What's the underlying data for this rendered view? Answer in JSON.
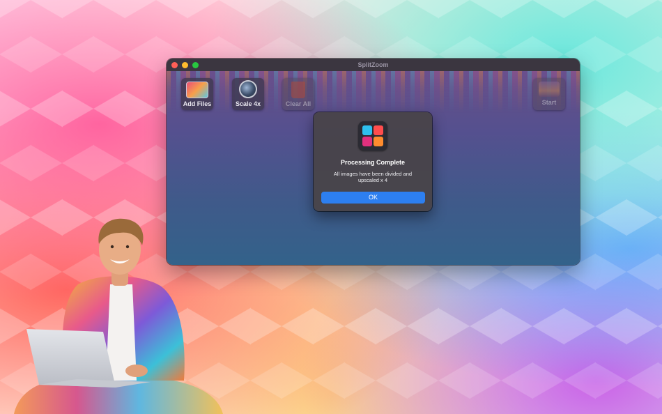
{
  "window": {
    "title": "SplitZoom"
  },
  "toolbar": {
    "add_files_label": "Add Files",
    "scale_label": "Scale 4x",
    "clear_all_label": "Clear All",
    "start_label": "Start"
  },
  "dialog": {
    "title": "Processing Complete",
    "message": "All images have been divided and upscaled x 4",
    "ok_label": "OK"
  },
  "colors": {
    "accent": "#2d7ff0",
    "icon_blue": "#2ec0ee",
    "icon_red": "#ff4d4d",
    "icon_pink": "#e0307e",
    "icon_orange": "#ff8c2e"
  },
  "icons": {
    "add_files": "photo-icon",
    "scale": "magnifier-lens-icon",
    "clear_all": "trash-icon",
    "start": "mountain-image-icon",
    "app": "split-grid-app-icon"
  }
}
